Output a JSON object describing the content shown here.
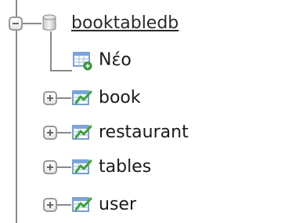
{
  "tree": {
    "database": {
      "name": "booktabledb",
      "expanded": true,
      "icon": "database-icon"
    },
    "new_item": {
      "label": "Νέο",
      "icon": "new-table-icon"
    },
    "tables": [
      {
        "label": "book",
        "icon": "table-icon",
        "expanded": false
      },
      {
        "label": "restaurant",
        "icon": "table-icon",
        "expanded": false
      },
      {
        "label": "tables",
        "icon": "table-icon",
        "expanded": false
      },
      {
        "label": "user",
        "icon": "table-icon",
        "expanded": false
      }
    ]
  },
  "colors": {
    "line": "#8a8a8a",
    "toggle_border": "#999999",
    "table_green": "#3fa33f",
    "table_blue": "#4a7fc1"
  }
}
